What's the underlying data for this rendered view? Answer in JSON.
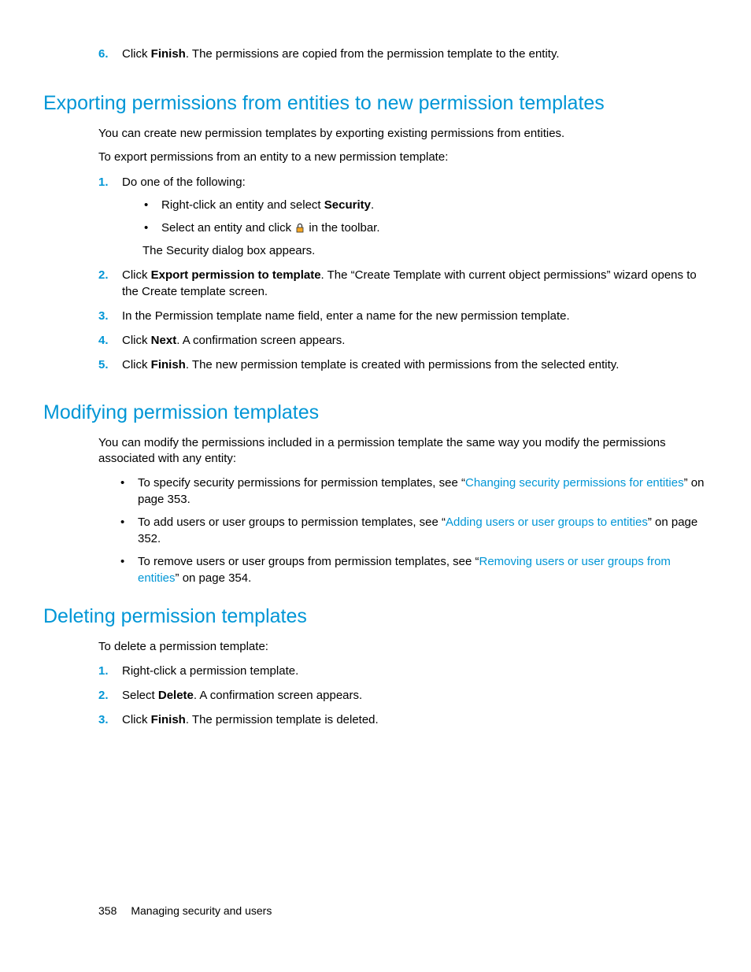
{
  "step6": {
    "text_before": "Click ",
    "bold": "Finish",
    "text_after": ". The permissions are copied from the permission template to the entity."
  },
  "section1": {
    "heading": "Exporting permissions from entities to new permission templates",
    "intro1": "You can create new permission templates by exporting existing permissions from entities.",
    "intro2": "To export permissions from an entity to a new permission template:",
    "step1": {
      "text": "Do one of the following:",
      "sub1_before": "Right-click an entity and select ",
      "sub1_bold": "Security",
      "sub1_after": ".",
      "sub2_before": "Select an entity and click ",
      "sub2_after": " in the toolbar.",
      "sub_result": "The Security dialog box appears."
    },
    "step2": {
      "before": "Click ",
      "bold": "Export permission to template",
      "after": ". The “Create Template with current object permissions” wizard opens to the Create template screen."
    },
    "step3": "In the Permission template name field, enter a name for the new permission template.",
    "step4": {
      "before": "Click ",
      "bold": "Next",
      "after": ". A confirmation screen appears."
    },
    "step5": {
      "before": "Click ",
      "bold": "Finish",
      "after": ". The new permission template is created with permissions from the selected entity."
    }
  },
  "section2": {
    "heading": "Modifying permission templates",
    "intro": "You can modify the permissions included in a permission template the same way you modify the permissions associated with any entity:",
    "b1_before": "To specify security permissions for permission templates, see “",
    "b1_link": "Changing security permissions for entities",
    "b1_after": "” on page 353.",
    "b2_before": "To add users or user groups to permission templates, see “",
    "b2_link": "Adding users or user groups to entities",
    "b2_after": "” on page 352.",
    "b3_before": "To remove users or user groups from permission templates, see “",
    "b3_link": "Removing users or user groups from entities",
    "b3_after": "” on page 354."
  },
  "section3": {
    "heading": "Deleting permission templates",
    "intro": "To delete a permission template:",
    "step1": "Right-click a permission template.",
    "step2": {
      "before": "Select ",
      "bold": "Delete",
      "after": ". A confirmation screen appears."
    },
    "step3": {
      "before": "Click ",
      "bold": "Finish",
      "after": ". The permission template is deleted."
    }
  },
  "footer": {
    "page": "358",
    "title": "Managing security and users"
  }
}
